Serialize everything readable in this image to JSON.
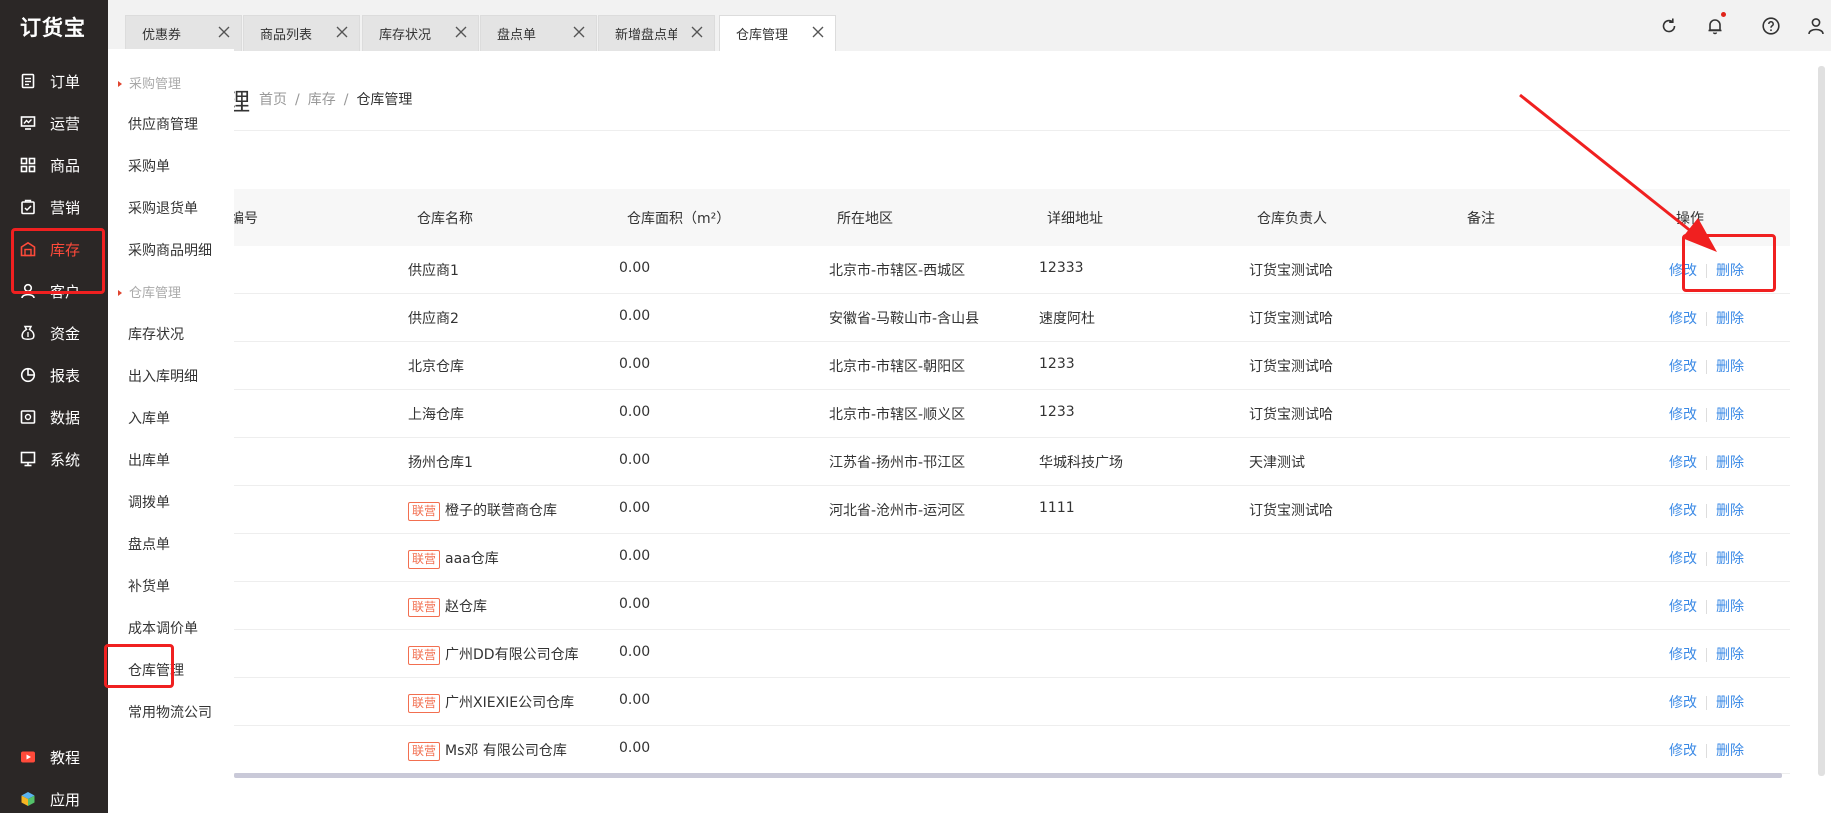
{
  "app": {
    "logo": "订货宝"
  },
  "sidebar": {
    "items": [
      {
        "label": "订单",
        "icon": "order-icon"
      },
      {
        "label": "运营",
        "icon": "operation-icon"
      },
      {
        "label": "商品",
        "icon": "goods-icon"
      },
      {
        "label": "营销",
        "icon": "marketing-icon"
      },
      {
        "label": "库存",
        "icon": "inventory-icon",
        "active": true
      },
      {
        "label": "客户",
        "icon": "customer-icon"
      },
      {
        "label": "资金",
        "icon": "funds-icon"
      },
      {
        "label": "报表",
        "icon": "report-icon"
      },
      {
        "label": "数据",
        "icon": "data-icon"
      },
      {
        "label": "系统",
        "icon": "system-icon"
      }
    ],
    "bottom": [
      {
        "label": "教程",
        "icon": "tutorial-icon"
      },
      {
        "label": "应用",
        "icon": "app-icon"
      }
    ],
    "accent_color": "#ff4a3a"
  },
  "submenu": {
    "group_purchase": "采购管理",
    "purchase_items": [
      "供应商管理",
      "采购单",
      "采购退货单",
      "采购商品明细"
    ],
    "group_warehouse": "仓库管理",
    "warehouse_items": [
      "库存状况",
      "出入库明细",
      "入库单",
      "出库单",
      "调拨单",
      "盘点单",
      "补货单",
      "成本调价单",
      "仓库管理",
      "常用物流公司"
    ]
  },
  "tabs": [
    {
      "label": "优惠券"
    },
    {
      "label": "商品列表"
    },
    {
      "label": "库存状况"
    },
    {
      "label": "盘点单"
    },
    {
      "label": "新增盘点单"
    },
    {
      "label": "仓库管理",
      "active": true
    }
  ],
  "topbar": {
    "icons": [
      "refresh-icon",
      "bell-icon",
      "help-icon",
      "user-icon"
    ]
  },
  "page": {
    "title_fragment": "理",
    "breadcrumb": {
      "home": "首页",
      "level2": "库存",
      "current": "仓库管理",
      "sep": "/"
    }
  },
  "table": {
    "headers": {
      "code": "编号",
      "name": "仓库名称",
      "area": "仓库面积（m²）",
      "region": "所在地区",
      "address": "详细地址",
      "manager": "仓库负责人",
      "remark": "备注",
      "ops": "操作"
    },
    "badge_label": "联营",
    "edit_label": "修改",
    "delete_label": "删除",
    "rows": [
      {
        "name": "供应商1",
        "badge": false,
        "area": "0.00",
        "region": "北京市-市辖区-西城区",
        "address": "12333",
        "manager": "订货宝测试哈"
      },
      {
        "name": "供应商2",
        "badge": false,
        "area": "0.00",
        "region": "安徽省-马鞍山市-含山县",
        "address": "速度阿杜",
        "manager": "订货宝测试哈"
      },
      {
        "name": "北京仓库",
        "badge": false,
        "area": "0.00",
        "region": "北京市-市辖区-朝阳区",
        "address": "1233",
        "manager": "订货宝测试哈"
      },
      {
        "name": "上海仓库",
        "badge": false,
        "area": "0.00",
        "region": "北京市-市辖区-顺义区",
        "address": "1233",
        "manager": "订货宝测试哈"
      },
      {
        "name": "扬州仓库1",
        "badge": false,
        "area": "0.00",
        "region": "江苏省-扬州市-邗江区",
        "address": "华城科技广场",
        "manager": "天津测试"
      },
      {
        "name": "橙子的联营商仓库",
        "badge": true,
        "area": "0.00",
        "region": "河北省-沧州市-运河区",
        "address": "1111",
        "manager": "订货宝测试哈"
      },
      {
        "name": "aaa仓库",
        "badge": true,
        "area": "0.00",
        "region": "",
        "address": "",
        "manager": ""
      },
      {
        "name": "赵仓库",
        "badge": true,
        "area": "0.00",
        "region": "",
        "address": "",
        "manager": ""
      },
      {
        "name": "广州DD有限公司仓库",
        "badge": true,
        "area": "0.00",
        "region": "",
        "address": "",
        "manager": ""
      },
      {
        "name": "广州XIEXIE公司仓库",
        "badge": true,
        "area": "0.00",
        "region": "",
        "address": "",
        "manager": ""
      },
      {
        "name": "Ms邓 有限公司仓库",
        "badge": true,
        "area": "0.00",
        "region": "",
        "address": "",
        "manager": ""
      }
    ]
  },
  "colors": {
    "link": "#3b8ae6",
    "annotation": "#f02020",
    "badge": "#f26f50"
  }
}
